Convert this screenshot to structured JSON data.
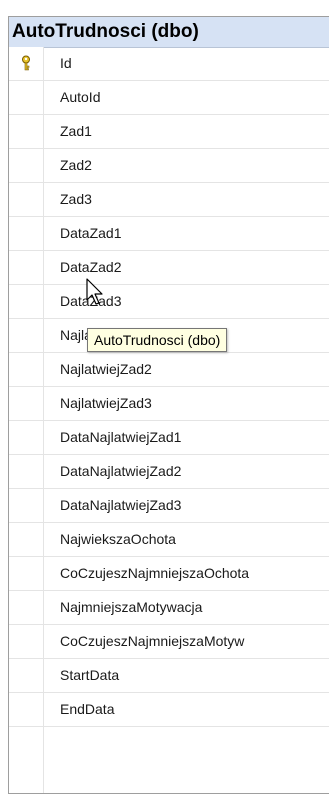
{
  "table": {
    "title": "AutoTrudnosci (dbo)",
    "columns": [
      {
        "name": "Id",
        "key": true
      },
      {
        "name": "AutoId",
        "key": false
      },
      {
        "name": "Zad1",
        "key": false
      },
      {
        "name": "Zad2",
        "key": false
      },
      {
        "name": "Zad3",
        "key": false
      },
      {
        "name": "DataZad1",
        "key": false
      },
      {
        "name": "DataZad2",
        "key": false
      },
      {
        "name": "DataZad3",
        "key": false
      },
      {
        "name": "NajlatwiejZad1",
        "key": false
      },
      {
        "name": "NajlatwiejZad2",
        "key": false
      },
      {
        "name": "NajlatwiejZad3",
        "key": false
      },
      {
        "name": "DataNajlatwiejZad1",
        "key": false
      },
      {
        "name": "DataNajlatwiejZad2",
        "key": false
      },
      {
        "name": "DataNajlatwiejZad3",
        "key": false
      },
      {
        "name": "NajwiekszaOchota",
        "key": false
      },
      {
        "name": "CoCzujeszNajmniejszaOchota",
        "key": false
      },
      {
        "name": "NajmniejszaMotywacja",
        "key": false
      },
      {
        "name": "CoCzujeszNajmniejszaMotyw",
        "key": false
      },
      {
        "name": "StartData",
        "key": false
      },
      {
        "name": "EndData",
        "key": false
      }
    ]
  },
  "tooltip": {
    "text": "AutoTrudnosci (dbo)"
  },
  "colors": {
    "header_bg": "#d6e2f4",
    "tooltip_bg": "#ffffe1",
    "key_icon": "#e8c42a"
  },
  "icons": {
    "key": "primary-key-icon",
    "cursor": "mouse-pointer-icon"
  }
}
